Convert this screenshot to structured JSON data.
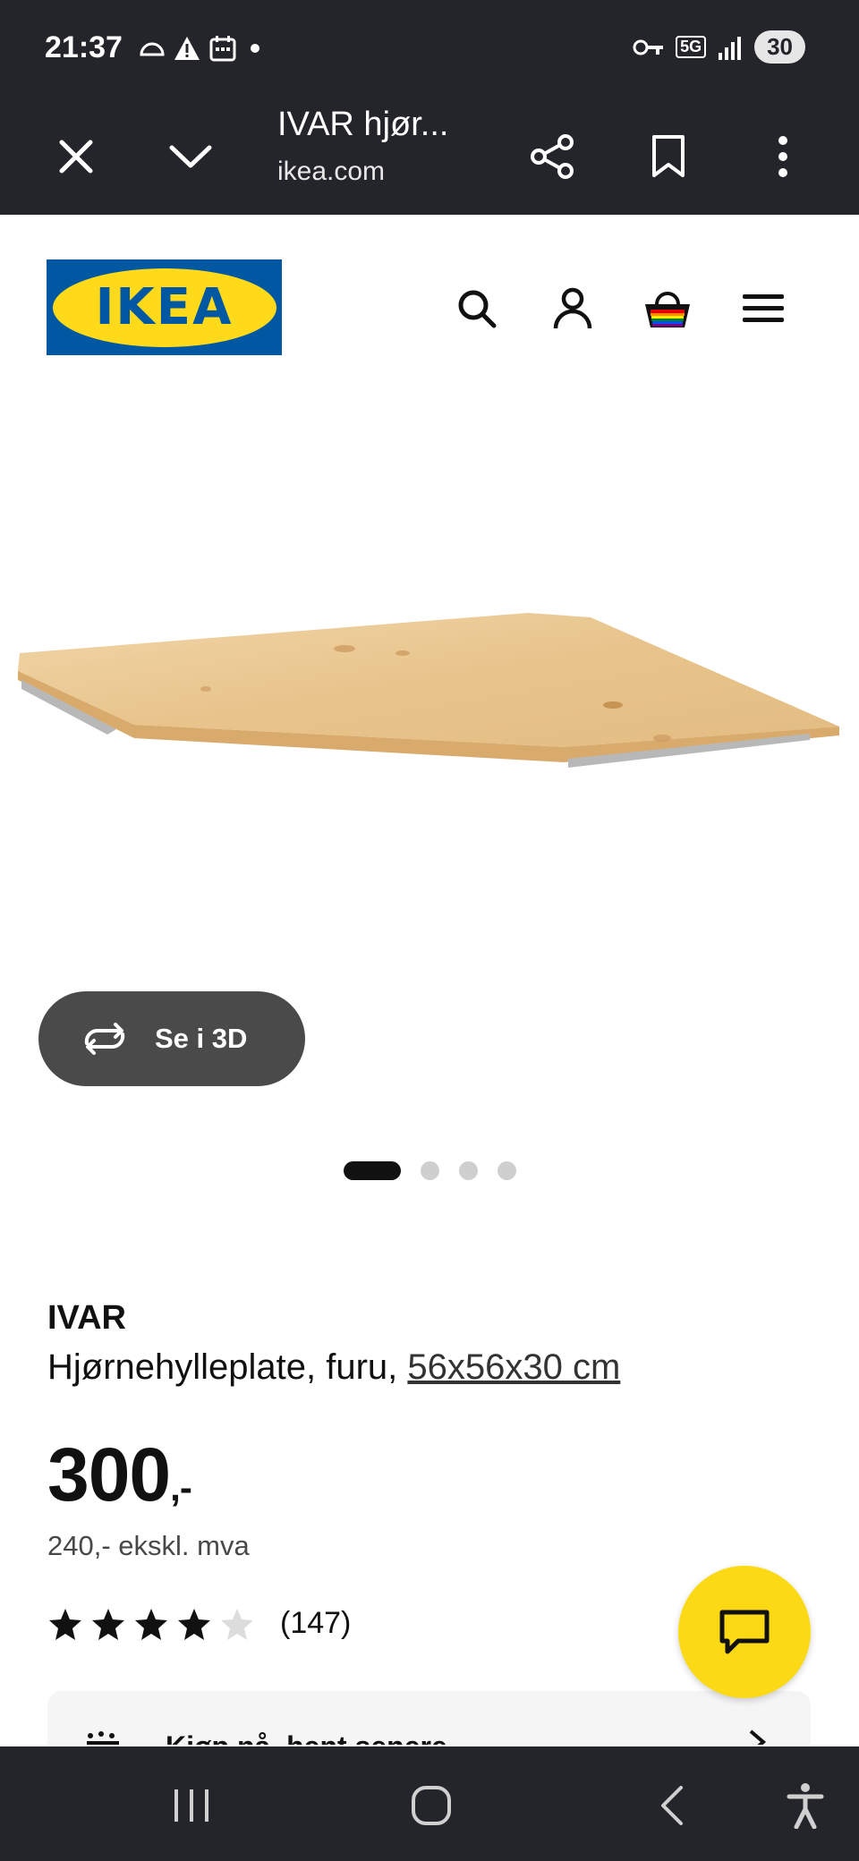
{
  "status": {
    "time": "21:37",
    "network": "5G",
    "battery": "30"
  },
  "browser": {
    "title": "IVAR hjør...",
    "url": "ikea.com"
  },
  "header": {
    "logo_text": "IKEA"
  },
  "gallery": {
    "view_3d_label": "Se i 3D",
    "slide_count": 4,
    "active_slide": 1
  },
  "product": {
    "name": "IVAR",
    "description": "Hjørnehylleplate, furu, ",
    "dimensions": "56x56x30 cm",
    "price": "300",
    "price_suffix": ",-",
    "price_ex_vat": "240,- ekskl. mva",
    "rating": 4,
    "rating_max": 5,
    "review_count": "(147)"
  },
  "store": {
    "label": "Kjøp nå, hent senere"
  },
  "colors": {
    "ikea_blue": "#0058a3",
    "ikea_yellow": "#ffda1a",
    "chat_yellow": "#fbd914",
    "dark_bar": "#24252a"
  }
}
